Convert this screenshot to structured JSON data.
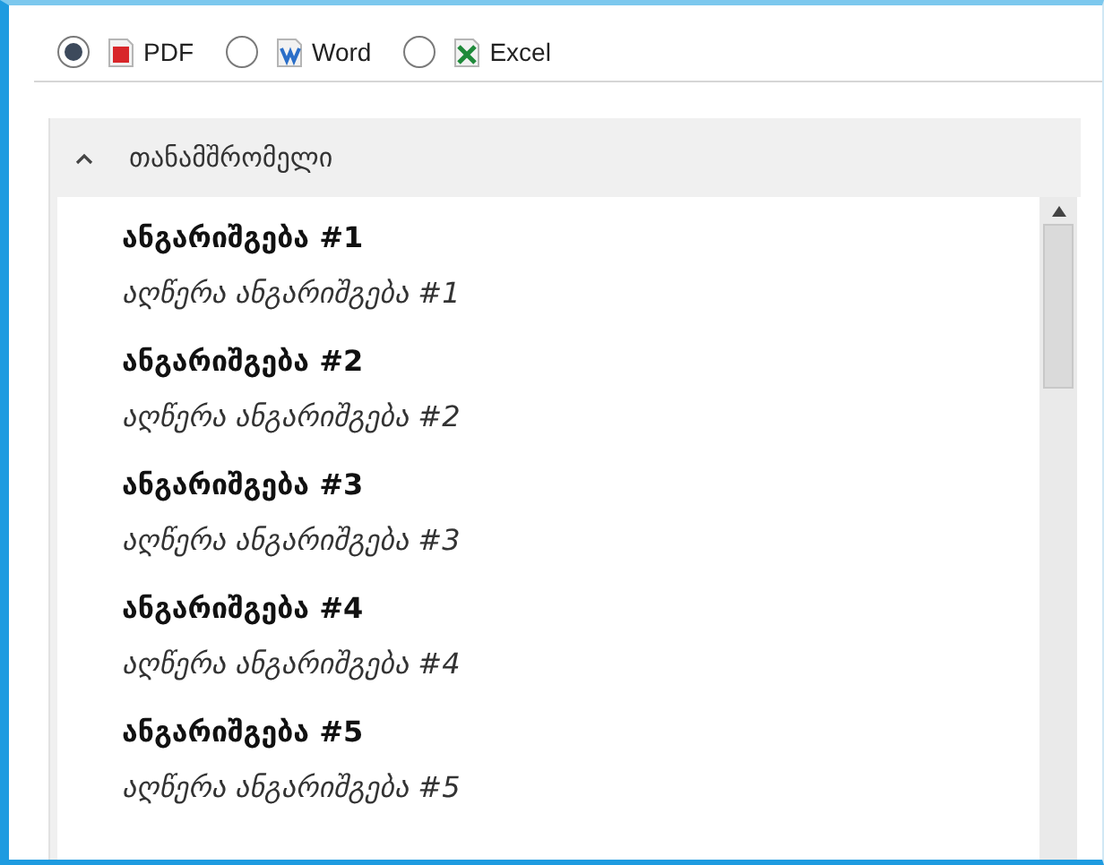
{
  "formats": [
    {
      "label": "PDF",
      "kind": "pdf",
      "selected": true
    },
    {
      "label": "Word",
      "kind": "word",
      "selected": false
    },
    {
      "label": "Excel",
      "kind": "excel",
      "selected": false
    }
  ],
  "group": {
    "title": "თანამშრომელი",
    "expanded": true,
    "items": [
      {
        "title": "ანგარიშგება #1",
        "description": "აღწერა ანგარიშგება #1"
      },
      {
        "title": "ანგარიშგება #2",
        "description": "აღწერა ანგარიშგება #2"
      },
      {
        "title": "ანგარიშგება #3",
        "description": "აღწერა ანგარიშგება #3"
      },
      {
        "title": "ანგარიშგება #4",
        "description": "აღწერა ანგარიშგება #4"
      },
      {
        "title": "ანგარიშგება #5",
        "description": "აღწერა ანგარიშგება #5"
      }
    ]
  }
}
